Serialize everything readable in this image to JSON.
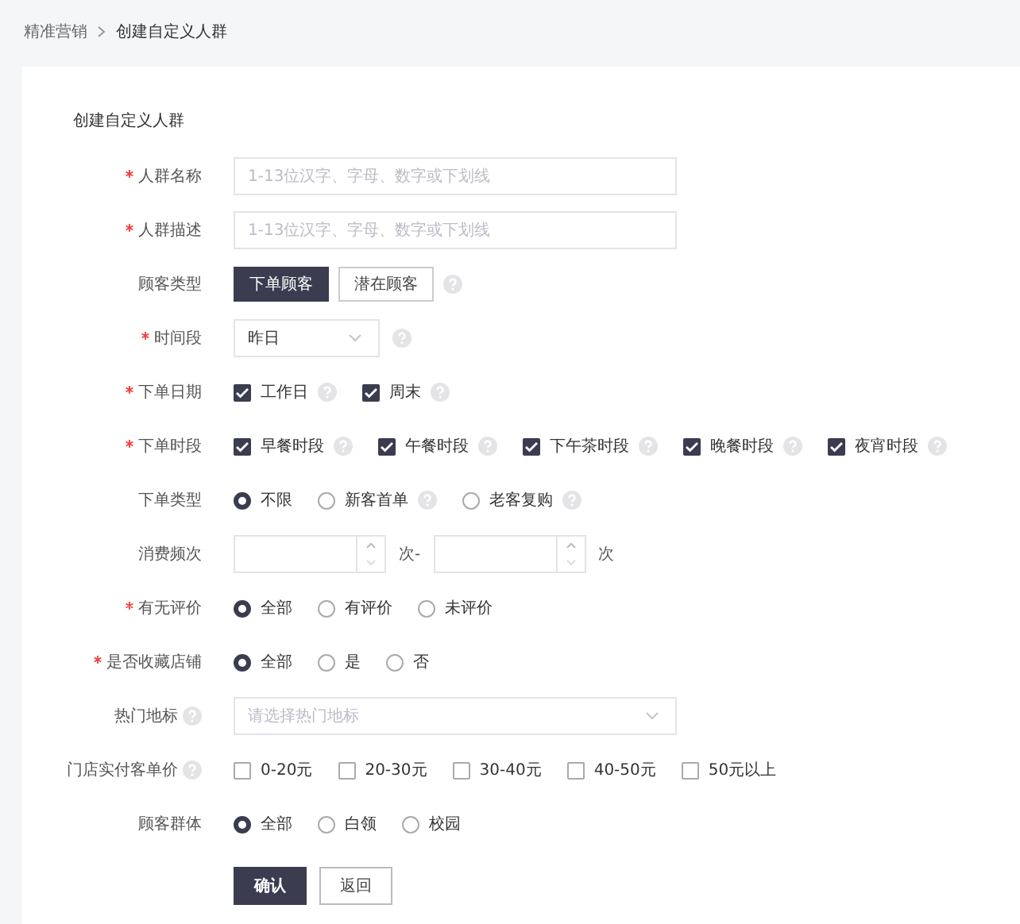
{
  "breadcrumb": [
    {
      "label": "精准营销"
    },
    {
      "label": "创建自定义人群"
    }
  ],
  "form": {
    "title": "创建自定义人群",
    "fields": [
      {
        "kind": "text",
        "label": "人群名称",
        "required": true,
        "placeholder": "1-13位汉字、字母、数字或下划线"
      },
      {
        "kind": "text",
        "label": "人群描述",
        "required": true,
        "placeholder": "1-13位汉字、字母、数字或下划线"
      },
      {
        "kind": "segmented",
        "label": "顾客类型",
        "required": false,
        "help": true,
        "options": [
          {
            "label": "下单顾客",
            "selected": true
          },
          {
            "label": "潜在顾客",
            "selected": false
          }
        ]
      },
      {
        "kind": "select",
        "label": "时间段",
        "required": true,
        "help": true,
        "value": "昨日",
        "wide": false
      },
      {
        "kind": "checkbox",
        "label": "下单日期",
        "required": true,
        "options": [
          {
            "label": "工作日",
            "checked": true,
            "help": true
          },
          {
            "label": "周末",
            "checked": true,
            "help": true
          }
        ]
      },
      {
        "kind": "checkbox",
        "label": "下单时段",
        "required": true,
        "options": [
          {
            "label": "早餐时段",
            "checked": true,
            "help": true
          },
          {
            "label": "午餐时段",
            "checked": true,
            "help": true
          },
          {
            "label": "下午茶时段",
            "checked": true,
            "help": true
          },
          {
            "label": "晚餐时段",
            "checked": true,
            "help": true
          },
          {
            "label": "夜宵时段",
            "checked": true,
            "help": true
          }
        ]
      },
      {
        "kind": "radio",
        "label": "下单类型",
        "required": false,
        "options": [
          {
            "label": "不限",
            "selected": true,
            "help": false
          },
          {
            "label": "新客首单",
            "selected": false,
            "help": true
          },
          {
            "label": "老客复购",
            "selected": false,
            "help": true
          }
        ]
      },
      {
        "kind": "range",
        "label": "消费频次",
        "required": false,
        "unit_from": "次-",
        "unit_to": "次"
      },
      {
        "kind": "radio",
        "label": "有无评价",
        "required": true,
        "options": [
          {
            "label": "全部",
            "selected": true,
            "help": false
          },
          {
            "label": "有评价",
            "selected": false,
            "help": false
          },
          {
            "label": "未评价",
            "selected": false,
            "help": false
          }
        ]
      },
      {
        "kind": "radio",
        "label": "是否收藏店铺",
        "required": true,
        "options": [
          {
            "label": "全部",
            "selected": true,
            "help": false
          },
          {
            "label": "是",
            "selected": false,
            "help": false
          },
          {
            "label": "否",
            "selected": false,
            "help": false
          }
        ]
      },
      {
        "kind": "select",
        "label": "热门地标",
        "required": false,
        "label_help": true,
        "placeholder": "请选择热门地标",
        "wide": true
      },
      {
        "kind": "checkbox",
        "label": "门店实付客单价",
        "required": false,
        "label_help": true,
        "options": [
          {
            "label": "0-20元",
            "checked": false,
            "help": false
          },
          {
            "label": "20-30元",
            "checked": false,
            "help": false
          },
          {
            "label": "30-40元",
            "checked": false,
            "help": false
          },
          {
            "label": "40-50元",
            "checked": false,
            "help": false
          },
          {
            "label": "50元以上",
            "checked": false,
            "help": false
          }
        ]
      },
      {
        "kind": "radio",
        "label": "顾客群体",
        "required": false,
        "options": [
          {
            "label": "全部",
            "selected": true,
            "help": false
          },
          {
            "label": "白领",
            "selected": false,
            "help": false
          },
          {
            "label": "校园",
            "selected": false,
            "help": false
          }
        ]
      }
    ],
    "buttons": [
      {
        "label": "确认",
        "kind": "primary"
      },
      {
        "label": "返回",
        "kind": "secondary"
      }
    ]
  }
}
